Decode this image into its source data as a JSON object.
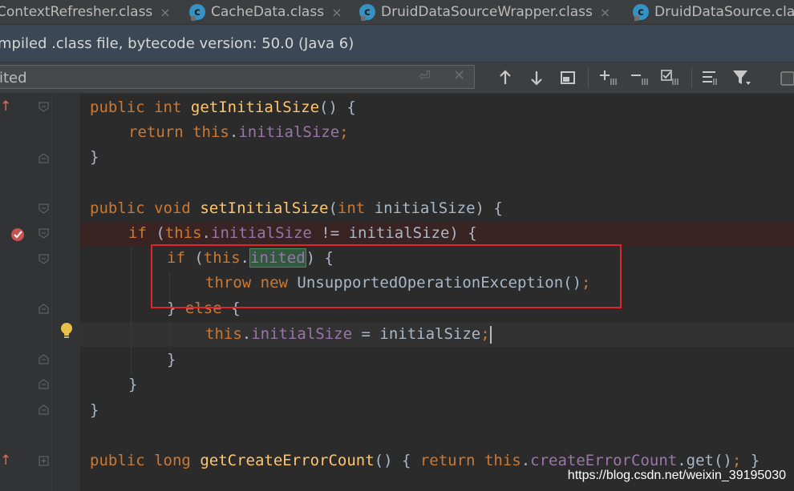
{
  "tabs": [
    {
      "label": "ContextRefresher.class",
      "icon": "class-icon"
    },
    {
      "label": "CacheData.class",
      "icon": "class-icon"
    },
    {
      "label": "DruidDataSourceWrapper.class",
      "icon": "class-icon"
    },
    {
      "label": "DruidDataSource.cla",
      "icon": "class-icon"
    }
  ],
  "tab_close": "×",
  "tab_icon_letter": "c",
  "banner": {
    "text": "mpiled .class file, bytecode version: 50.0 (Java 6)"
  },
  "search": {
    "value": "ited"
  },
  "code": {
    "l1": {
      "kw1": "public",
      "kw2": "int",
      "fn": "getInitialSize",
      "rest": "() {"
    },
    "l2": {
      "kw": "return",
      "this": "this",
      "dot": ".",
      "field": "initialSize",
      "semi": ";"
    },
    "l3": "}",
    "l5": {
      "kw1": "public",
      "kw2": "void",
      "fn": "setInitialSize",
      "open": "(",
      "kw3": "int",
      "param": " initialSize) {"
    },
    "l6": {
      "kw": "if",
      "open": " (",
      "this": "this",
      "dot": ".",
      "field": "initialSize",
      "rest": " != initialSize) {"
    },
    "l7": {
      "kw": "if",
      "open": " (",
      "this": "this",
      "dot": ".",
      "field": "inited",
      "rest": ") {"
    },
    "l8": {
      "kw1": "throw",
      "kw2": "new",
      "rest": " UnsupportedOperationException()",
      "semi": ";"
    },
    "l9": {
      "close": "} ",
      "kw": "else",
      "rest": " {"
    },
    "l10": {
      "this": "this",
      "dot": ".",
      "field": "initialSize",
      "rest": " = initialSize",
      "semi": ";"
    },
    "l11": "}",
    "l12": "}",
    "l13": "}",
    "l15": {
      "kw1": "public",
      "kw2": "long",
      "fn": "getCreateErrorCount",
      "rest": "() { ",
      "kw3": "return",
      "this": "this",
      "dot": ".",
      "field": "createErrorCount",
      "rest2": ".get()",
      "semi": ";",
      "close": " }"
    }
  },
  "watermark": "https://blog.csdn.net/weixin_39195030",
  "colors": {
    "keyword": "#cc7832",
    "method": "#ffc66d",
    "field": "#9876aa",
    "text": "#a9b7c6",
    "highlight_box": "#e0242b"
  }
}
